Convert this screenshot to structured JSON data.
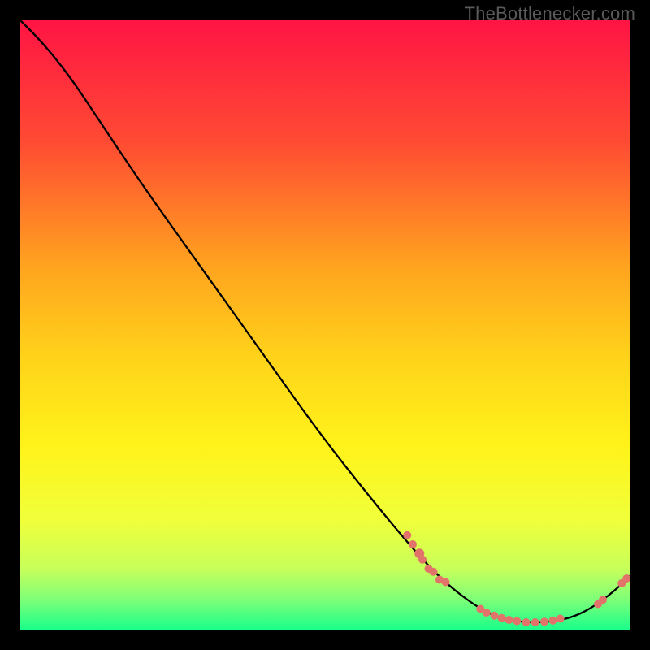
{
  "watermark": "TheBottlenecker.com",
  "chart_data": {
    "type": "line",
    "title": "",
    "xlabel": "",
    "ylabel": "",
    "xlim": [
      0,
      100
    ],
    "ylim": [
      0,
      100
    ],
    "grid": false,
    "gradient_stops": [
      {
        "offset": 0,
        "color": "#ff1444"
      },
      {
        "offset": 0.2,
        "color": "#ff4b33"
      },
      {
        "offset": 0.4,
        "color": "#ffa21f"
      },
      {
        "offset": 0.55,
        "color": "#ffd21a"
      },
      {
        "offset": 0.7,
        "color": "#fff31a"
      },
      {
        "offset": 0.82,
        "color": "#f0ff3a"
      },
      {
        "offset": 0.9,
        "color": "#c7ff5a"
      },
      {
        "offset": 0.95,
        "color": "#7fff78"
      },
      {
        "offset": 1.0,
        "color": "#1aff8a"
      }
    ],
    "series": [
      {
        "name": "curve",
        "points": [
          {
            "x": 0,
            "y": 100
          },
          {
            "x": 3,
            "y": 97
          },
          {
            "x": 6,
            "y": 93.5
          },
          {
            "x": 9,
            "y": 89.5
          },
          {
            "x": 12,
            "y": 85
          },
          {
            "x": 20,
            "y": 73
          },
          {
            "x": 30,
            "y": 59
          },
          {
            "x": 40,
            "y": 45
          },
          {
            "x": 50,
            "y": 31
          },
          {
            "x": 60,
            "y": 18.5
          },
          {
            "x": 66,
            "y": 11.5
          },
          {
            "x": 70,
            "y": 7.5
          },
          {
            "x": 74,
            "y": 4.4
          },
          {
            "x": 77,
            "y": 2.6
          },
          {
            "x": 80,
            "y": 1.6
          },
          {
            "x": 83,
            "y": 1.2
          },
          {
            "x": 86,
            "y": 1.2
          },
          {
            "x": 89,
            "y": 1.6
          },
          {
            "x": 92,
            "y": 2.6
          },
          {
            "x": 95,
            "y": 4.4
          },
          {
            "x": 98,
            "y": 6.8
          },
          {
            "x": 100,
            "y": 8.8
          }
        ]
      }
    ],
    "scatter": [
      {
        "x": 63.5,
        "y": 15.5,
        "r": 5
      },
      {
        "x": 64.4,
        "y": 14.0,
        "r": 5
      },
      {
        "x": 65.5,
        "y": 12.5,
        "r": 6
      },
      {
        "x": 66.0,
        "y": 11.5,
        "r": 5
      },
      {
        "x": 67.0,
        "y": 10.0,
        "r": 5
      },
      {
        "x": 67.8,
        "y": 9.5,
        "r": 5
      },
      {
        "x": 68.8,
        "y": 8.2,
        "r": 5
      },
      {
        "x": 69.8,
        "y": 7.8,
        "r": 5
      },
      {
        "x": 75.5,
        "y": 3.4,
        "r": 5
      },
      {
        "x": 76.5,
        "y": 2.8,
        "r": 5
      },
      {
        "x": 77.8,
        "y": 2.3,
        "r": 5
      },
      {
        "x": 79.0,
        "y": 1.9,
        "r": 5
      },
      {
        "x": 80.2,
        "y": 1.6,
        "r": 5
      },
      {
        "x": 81.5,
        "y": 1.4,
        "r": 5
      },
      {
        "x": 83.0,
        "y": 1.2,
        "r": 5
      },
      {
        "x": 84.5,
        "y": 1.2,
        "r": 5
      },
      {
        "x": 86.0,
        "y": 1.3,
        "r": 5
      },
      {
        "x": 87.4,
        "y": 1.5,
        "r": 5
      },
      {
        "x": 88.6,
        "y": 1.8,
        "r": 5
      },
      {
        "x": 94.8,
        "y": 4.2,
        "r": 5
      },
      {
        "x": 95.6,
        "y": 4.9,
        "r": 5
      },
      {
        "x": 98.7,
        "y": 7.6,
        "r": 5
      },
      {
        "x": 99.5,
        "y": 8.4,
        "r": 5
      }
    ],
    "scatter_color": "#e2736b"
  }
}
